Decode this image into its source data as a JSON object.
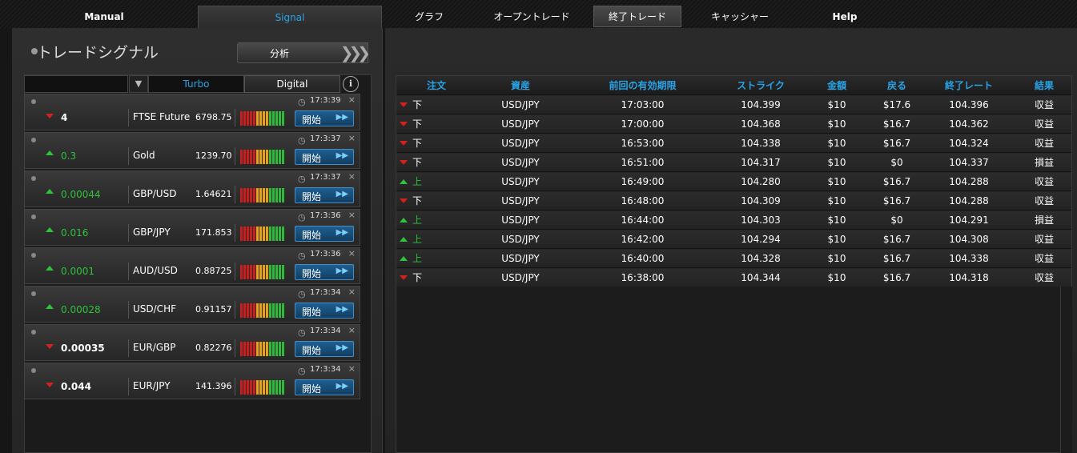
{
  "nav": {
    "left_tabs": [
      {
        "label": "Manual"
      },
      {
        "label": "Signal",
        "active": true
      }
    ],
    "right_tabs": [
      {
        "label": "グラフ"
      },
      {
        "label": "オープントレード"
      },
      {
        "label": "終了トレード",
        "active": true
      },
      {
        "label": "キャッシャー"
      },
      {
        "label": "Help"
      }
    ]
  },
  "signals_panel": {
    "title": "トレードシグナル",
    "analyze_label": "分析",
    "tabs": {
      "turbo": "Turbo",
      "digital": "Digital"
    },
    "info_icon": "i",
    "start_label": "開始",
    "close_glyph": "×",
    "rows": [
      {
        "time": "17:3:39",
        "direction": "down",
        "change": "4",
        "asset": "FTSE Future",
        "price": "6798.75"
      },
      {
        "time": "17:3:37",
        "direction": "up",
        "change": "0.3",
        "asset": "Gold",
        "price": "1239.70"
      },
      {
        "time": "17:3:37",
        "direction": "up",
        "change": "0.00044",
        "asset": "GBP/USD",
        "price": "1.64621"
      },
      {
        "time": "17:3:36",
        "direction": "up",
        "change": "0.016",
        "asset": "GBP/JPY",
        "price": "171.853"
      },
      {
        "time": "17:3:36",
        "direction": "up",
        "change": "0.0001",
        "asset": "AUD/USD",
        "price": "0.88725"
      },
      {
        "time": "17:3:34",
        "direction": "up",
        "change": "0.00028",
        "asset": "USD/CHF",
        "price": "0.91157"
      },
      {
        "time": "17:3:34",
        "direction": "down",
        "change": "0.00035",
        "asset": "EUR/GBP",
        "price": "0.82276"
      },
      {
        "time": "17:3:34",
        "direction": "down",
        "change": "0.044",
        "asset": "EUR/JPY",
        "price": "141.396"
      }
    ]
  },
  "closed_trades": {
    "columns": [
      "注文",
      "資産",
      "前回の有効期限",
      "ストライク",
      "金額",
      "戻る",
      "終了レート",
      "結果"
    ],
    "rows": [
      {
        "direction": "down",
        "order": "下",
        "asset": "USD/JPY",
        "expiry": "17:03:00",
        "strike": "104.399",
        "amount": "$10",
        "return": "$17.6",
        "close_rate": "104.396",
        "result": "収益"
      },
      {
        "direction": "down",
        "order": "下",
        "asset": "USD/JPY",
        "expiry": "17:00:00",
        "strike": "104.368",
        "amount": "$10",
        "return": "$16.7",
        "close_rate": "104.362",
        "result": "収益"
      },
      {
        "direction": "down",
        "order": "下",
        "asset": "USD/JPY",
        "expiry": "16:53:00",
        "strike": "104.338",
        "amount": "$10",
        "return": "$16.7",
        "close_rate": "104.324",
        "result": "収益"
      },
      {
        "direction": "down",
        "order": "下",
        "asset": "USD/JPY",
        "expiry": "16:51:00",
        "strike": "104.317",
        "amount": "$10",
        "return": "$0",
        "close_rate": "104.337",
        "result": "損益"
      },
      {
        "direction": "up",
        "order": "上",
        "asset": "USD/JPY",
        "expiry": "16:49:00",
        "strike": "104.280",
        "amount": "$10",
        "return": "$16.7",
        "close_rate": "104.288",
        "result": "収益"
      },
      {
        "direction": "down",
        "order": "下",
        "asset": "USD/JPY",
        "expiry": "16:48:00",
        "strike": "104.309",
        "amount": "$10",
        "return": "$16.7",
        "close_rate": "104.288",
        "result": "収益"
      },
      {
        "direction": "up",
        "order": "上",
        "asset": "USD/JPY",
        "expiry": "16:44:00",
        "strike": "104.303",
        "amount": "$10",
        "return": "$0",
        "close_rate": "104.291",
        "result": "損益"
      },
      {
        "direction": "up",
        "order": "上",
        "asset": "USD/JPY",
        "expiry": "16:42:00",
        "strike": "104.294",
        "amount": "$10",
        "return": "$16.7",
        "close_rate": "104.308",
        "result": "収益"
      },
      {
        "direction": "up",
        "order": "上",
        "asset": "USD/JPY",
        "expiry": "16:40:00",
        "strike": "104.328",
        "amount": "$10",
        "return": "$16.7",
        "close_rate": "104.338",
        "result": "収益"
      },
      {
        "direction": "down",
        "order": "下",
        "asset": "USD/JPY",
        "expiry": "16:38:00",
        "strike": "104.344",
        "amount": "$10",
        "return": "$16.7",
        "close_rate": "104.318",
        "result": "収益"
      }
    ]
  },
  "colors": {
    "accent": "#29a3e6",
    "up": "#2fc23a",
    "down": "#d62020"
  }
}
